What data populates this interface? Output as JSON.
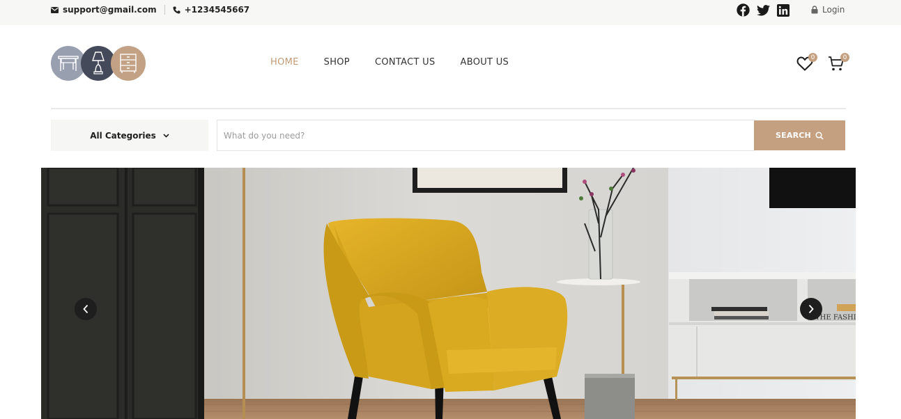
{
  "topbar": {
    "email": "support@gmail.com",
    "phone": "+1234545667",
    "social": [
      "facebook-icon",
      "twitter-icon",
      "linkedin-icon"
    ],
    "login_label": "Login"
  },
  "nav": {
    "items": [
      {
        "label": "HOME",
        "active": true
      },
      {
        "label": "SHOP",
        "active": false
      },
      {
        "label": "CONTACT US",
        "active": false
      },
      {
        "label": "ABOUT US",
        "active": false
      }
    ]
  },
  "header": {
    "wishlist_count": "0",
    "cart_count": "0"
  },
  "search": {
    "category_label": "All Categories",
    "placeholder": "What do you need?",
    "button_label": "SEARCH"
  },
  "hero": {
    "magazine_text": "THE FASHI"
  },
  "colors": {
    "accent": "#c4a081",
    "nav_active": "#c29a78",
    "topbar_bg": "#f7f7f5"
  }
}
